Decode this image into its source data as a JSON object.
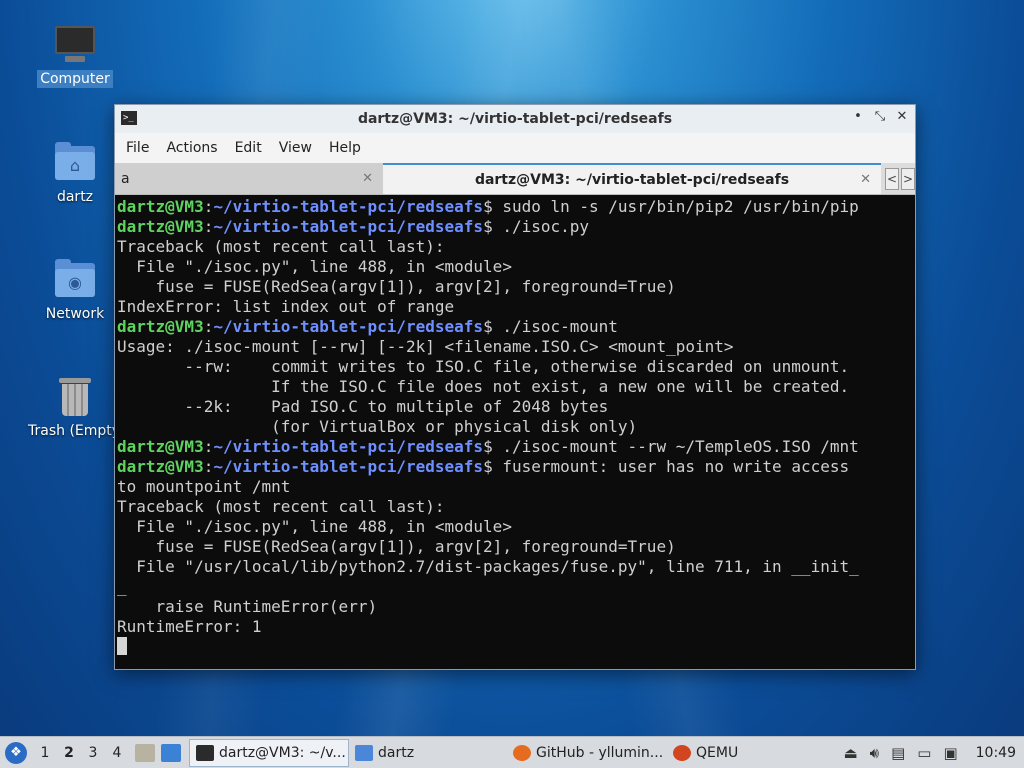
{
  "desktop": {
    "icons": [
      {
        "label": "Computer",
        "icon": "computer-icon"
      },
      {
        "label": "dartz",
        "icon": "home-folder-icon"
      },
      {
        "label": "Network",
        "icon": "network-folder-icon"
      },
      {
        "label": "Trash (Empty)",
        "icon": "trash-icon"
      }
    ]
  },
  "window": {
    "title": "dartz@VM3: ~/virtio-tablet-pci/redseafs",
    "controls": {
      "minimize": "•",
      "maximize": "⤡",
      "close": "✕"
    },
    "menu": [
      "File",
      "Actions",
      "Edit",
      "View",
      "Help"
    ],
    "tabs": [
      {
        "label": "a",
        "close": "✕"
      },
      {
        "label": "dartz@VM3: ~/virtio-tablet-pci/redseafs",
        "close": "✕"
      }
    ],
    "tab_nav": {
      "prev": "<",
      "next": ">"
    }
  },
  "terminal": {
    "user": "dartz@VM3",
    "path": "~/virtio-tablet-pci/redseafs",
    "lines": [
      {
        "prompt": true,
        "cmd": " sudo ln -s /usr/bin/pip2 /usr/bin/pip"
      },
      {
        "prompt": true,
        "cmd": " ./isoc.py"
      },
      {
        "text": "Traceback (most recent call last):"
      },
      {
        "text": "  File \"./isoc.py\", line 488, in <module>"
      },
      {
        "text": "    fuse = FUSE(RedSea(argv[1]), argv[2], foreground=True)"
      },
      {
        "text": "IndexError: list index out of range"
      },
      {
        "prompt": true,
        "cmd": " ./isoc-mount"
      },
      {
        "text": "Usage: ./isoc-mount [--rw] [--2k] <filename.ISO.C> <mount_point>"
      },
      {
        "text": "       --rw:    commit writes to ISO.C file, otherwise discarded on unmount."
      },
      {
        "text": "                If the ISO.C file does not exist, a new one will be created."
      },
      {
        "text": "       --2k:    Pad ISO.C to multiple of 2048 bytes"
      },
      {
        "text": "                (for VirtualBox or physical disk only)"
      },
      {
        "prompt": true,
        "cmd": " ./isoc-mount --rw ~/TempleOS.ISO /mnt"
      },
      {
        "prompt": true,
        "cmd": " fusermount: user has no write access"
      },
      {
        "text": "to mountpoint /mnt"
      },
      {
        "text": "Traceback (most recent call last):"
      },
      {
        "text": "  File \"./isoc.py\", line 488, in <module>"
      },
      {
        "text": "    fuse = FUSE(RedSea(argv[1]), argv[2], foreground=True)"
      },
      {
        "text": "  File \"/usr/local/lib/python2.7/dist-packages/fuse.py\", line 711, in __init_"
      },
      {
        "text": "_"
      },
      {
        "text": "    raise RuntimeError(err)"
      },
      {
        "text": "RuntimeError: 1"
      },
      {
        "cursor": true
      }
    ]
  },
  "taskbar": {
    "start_icon": "lxqt-start-icon",
    "workspaces": [
      "1",
      "2",
      "3",
      "4"
    ],
    "active_workspace": "2",
    "tasks": [
      {
        "label": "dartz@VM3: ~/v...",
        "icon": "terminal-icon",
        "color": "#2b2b2b",
        "active": true
      },
      {
        "label": "dartz",
        "icon": "folder-icon",
        "color": "#4a87d8",
        "active": false
      },
      {
        "label": "GitHub - yllumin...",
        "icon": "firefox-icon",
        "color": "#e66b1e",
        "active": false
      },
      {
        "label": "QEMU",
        "icon": "qemu-icon",
        "color": "#d2461f",
        "active": false
      }
    ],
    "clock": "10:49"
  },
  "colors": {
    "prompt_user": "#5fd35f",
    "prompt_path": "#6e8fff",
    "terminal_bg": "#0c0c0c",
    "selection": "#3c7fc2"
  }
}
